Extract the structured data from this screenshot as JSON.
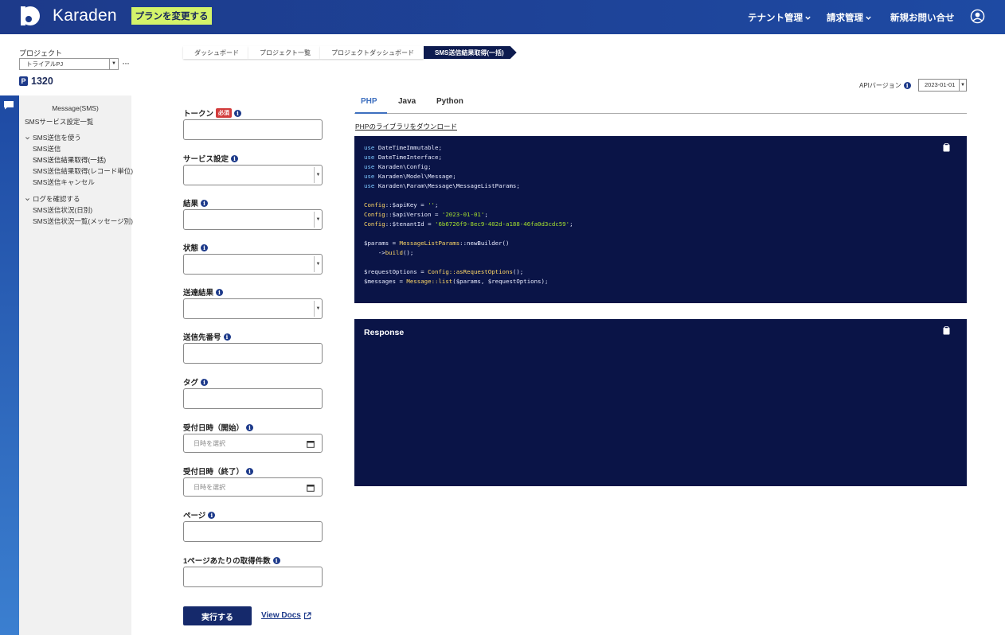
{
  "header": {
    "brand": "Karaden",
    "plan_button": "プランを変更する",
    "nav": {
      "tenant": "テナント管理",
      "billing": "請求管理",
      "new_inquiry": "新規お問い合せ"
    }
  },
  "sidebar": {
    "project_label": "プロジェクト",
    "project_select": "トライアルPJ",
    "points": "1320",
    "section_title": "Message(SMS)",
    "service_list": "SMSサービス設定一覧",
    "group_use": "SMS送信を使う",
    "items_use": [
      "SMS送信",
      "SMS送信結果取得(一括)",
      "SMS送信結果取得(レコード単位)",
      "SMS送信キャンセル"
    ],
    "group_log": "ログを確認する",
    "items_log": [
      "SMS送信状況(日別)",
      "SMS送信状況一覧(メッセージ別)"
    ]
  },
  "breadcrumb": [
    "ダッシュボード",
    "プロジェクト一覧",
    "プロジェクトダッシュボード",
    "SMS送信結果取得(一括)"
  ],
  "form": {
    "token": "トークン",
    "required": "必須",
    "service": "サービス設定",
    "result": "結果",
    "status": "状態",
    "delivery_result": "送達結果",
    "to_number": "送信先番号",
    "tag": "タグ",
    "received_start": "受付日時（開始）",
    "received_end": "受付日時（終了）",
    "date_placeholder": "日時を選択",
    "page": "ページ",
    "per_page": "1ページあたりの取得件数",
    "run_button": "実行する",
    "view_docs": "View Docs"
  },
  "api": {
    "version_label": "APIバージョン",
    "version_value": "2023-01-01"
  },
  "tabs": [
    "PHP",
    "Java",
    "Python"
  ],
  "download_link": "PHPのライブラリをダウンロード",
  "code": {
    "uses": [
      "DateTimeImmutable;",
      "DateTimeInterface;",
      "Karaden\\Config;",
      "Karaden\\Model\\Message;",
      "Karaden\\Param\\Message\\MessageListParams;"
    ],
    "use_kw": "use",
    "config_cls": "Config",
    "api_key_line": "::$apiKey = ",
    "api_key_val": "''",
    "api_version_line": "::$apiVersion = ",
    "api_version_val": "'2023-01-01'",
    "tenant_line": "::$tenantId = ",
    "tenant_val": "'6b6726f9-8ec9-402d-a188-46fa0d3cdc59'",
    "semicolon": ";",
    "params_var": "$params = ",
    "params_cls": "MessageListParams",
    "new_builder": "::newBuilder()",
    "build_indent": "    ->",
    "build_fn": "build",
    "build_end": "();",
    "req_var": "$requestOptions = ",
    "as_req": "::asRequestOptions",
    "as_req_end": "();",
    "msgs_var": "$messages = ",
    "msg_cls": "Message",
    "list_fn": "::list",
    "list_args": "($params, $requestOptions);"
  },
  "response": {
    "title": "Response"
  }
}
